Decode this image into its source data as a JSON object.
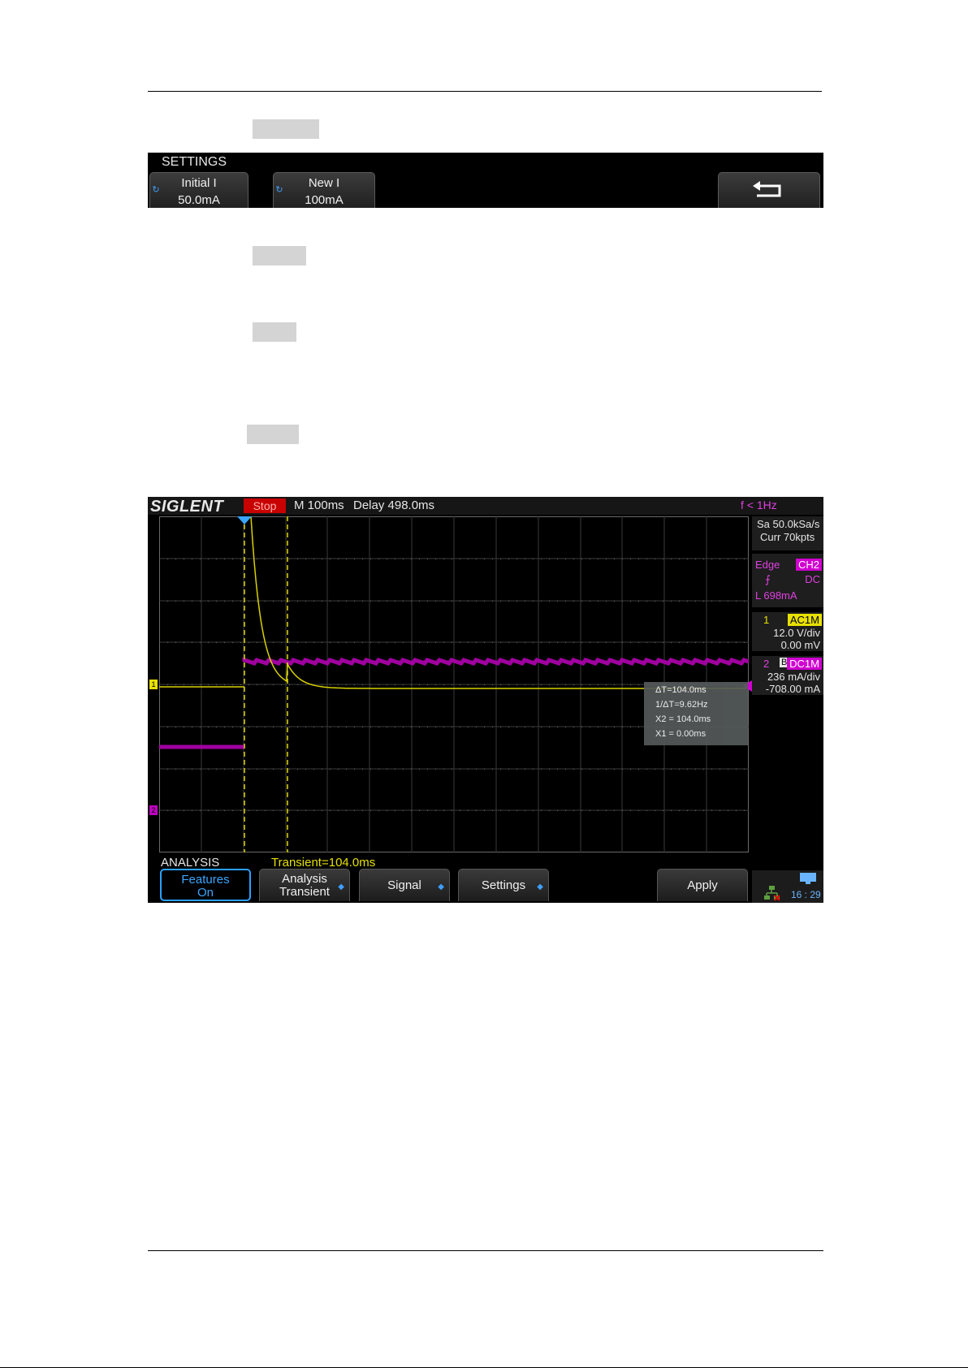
{
  "settings": {
    "title": "SETTINGS",
    "buttons": [
      {
        "line1": "Initial I",
        "line2": "50.0mA"
      },
      {
        "line1": "New I",
        "line2": "100mA"
      }
    ]
  },
  "scope": {
    "brand": "SIGLENT",
    "status": "Stop",
    "timebase": "M 100ms",
    "delay": "Delay 498.0ms",
    "freq": "f < 1Hz",
    "sample_rate": "Sa 50.0kSa/s",
    "memory": "Curr 70kpts",
    "trigger": {
      "type": "Edge",
      "source": "CH2",
      "coupling": "DC",
      "level": "L  698mA"
    },
    "ch1": {
      "num": "1",
      "coupling": "AC1M",
      "scale": "12.0 V/div",
      "offset": "0.00 mV"
    },
    "ch2": {
      "num": "2",
      "bw": "B",
      "coupling": "DC1M",
      "scale": "236 mA/div",
      "offset": "-708.00 mA"
    },
    "cursor": {
      "dt": "ΔT=104.0ms",
      "inv_dt": "1/ΔT=9.62Hz",
      "x2": "X2 = 104.0ms",
      "x1": "X1 = 0.00ms"
    },
    "analysis": {
      "title": "ANALYSIS",
      "value": "Transient=104.0ms"
    },
    "menu": [
      {
        "line1": "Features",
        "line2": "On"
      },
      {
        "line1": "Analysis",
        "line2": "Transient"
      },
      {
        "line1": "Signal",
        "line2": ""
      },
      {
        "line1": "Settings",
        "line2": ""
      },
      {
        "line1": "Apply",
        "line2": ""
      }
    ],
    "clock": "16 : 29",
    "colors": {
      "ch1": "#e8e000",
      "ch2": "#c000c0",
      "grid": "#4a4a4a",
      "accent": "#2aa0ff"
    }
  }
}
